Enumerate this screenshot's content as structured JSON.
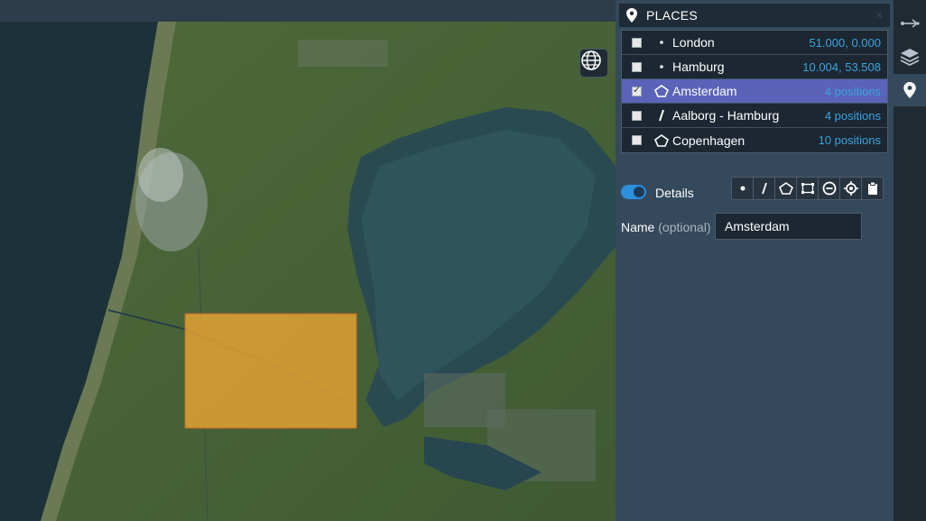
{
  "panel": {
    "title": "PLACES",
    "close_glyph": "×",
    "places": [
      {
        "type": "point",
        "name": "London",
        "value": "51.000, 0.000",
        "checked": false,
        "selected": false
      },
      {
        "type": "point",
        "name": "Hamburg",
        "value": "10.004, 53.508",
        "checked": false,
        "selected": false
      },
      {
        "type": "polygon",
        "name": "Amsterdam",
        "value": "4 positions",
        "checked": true,
        "selected": true
      },
      {
        "type": "line",
        "name": "Aalborg - Hamburg",
        "value": "4 positions",
        "checked": false,
        "selected": false
      },
      {
        "type": "polygon",
        "name": "Copenhagen",
        "value": "10 positions",
        "checked": false,
        "selected": false
      }
    ],
    "details_label": "Details",
    "details_enabled": true,
    "tools": [
      "point-tool-icon",
      "line-tool-icon",
      "polygon-tool-icon",
      "rectangle-tool-icon",
      "remove-icon",
      "locate-icon",
      "clipboard-icon"
    ],
    "name_label": "Name",
    "name_optional": "(optional)",
    "name_value": "Amsterdam"
  },
  "map": {
    "selected_area_color": "#e8a533"
  },
  "colors": {
    "accent": "#2d8fe0",
    "selected_row": "#5a63b8",
    "value_text": "#3aa3e0"
  }
}
